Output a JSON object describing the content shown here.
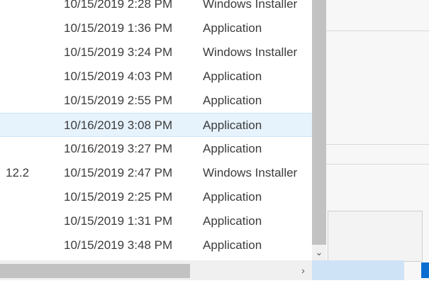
{
  "rows": [
    {
      "version": "",
      "date": "10/15/2019 2:28 PM",
      "type": "Windows Installer",
      "selected": false
    },
    {
      "version": "",
      "date": "10/15/2019 1:36 PM",
      "type": "Application",
      "selected": false
    },
    {
      "version": "",
      "date": "10/15/2019 3:24 PM",
      "type": "Windows Installer",
      "selected": false
    },
    {
      "version": "",
      "date": "10/15/2019 4:03 PM",
      "type": "Application",
      "selected": false
    },
    {
      "version": "",
      "date": "10/15/2019 2:55 PM",
      "type": "Application",
      "selected": false
    },
    {
      "version": "",
      "date": "10/16/2019 3:08 PM",
      "type": "Application",
      "selected": true
    },
    {
      "version": "",
      "date": "10/16/2019 3:27 PM",
      "type": "Application",
      "selected": false
    },
    {
      "version": "12.2",
      "date": "10/15/2019 2:47 PM",
      "type": "Windows Installer",
      "selected": false
    },
    {
      "version": "",
      "date": "10/15/2019 2:25 PM",
      "type": "Application",
      "selected": false
    },
    {
      "version": "",
      "date": "10/15/2019 1:31 PM",
      "type": "Application",
      "selected": false
    },
    {
      "version": "",
      "date": "10/15/2019 3:48 PM",
      "type": "Application",
      "selected": false
    }
  ],
  "scroll": {
    "down_arrow": "⌄",
    "right_arrow": "›"
  },
  "colors": {
    "selected_row": "#e6f2fc",
    "accent": "#0a6ed1"
  }
}
